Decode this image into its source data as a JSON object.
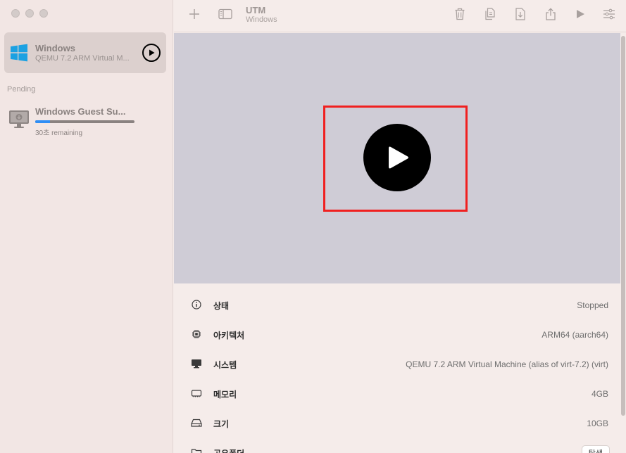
{
  "sidebar": {
    "vm": {
      "name": "Windows",
      "subtitle": "QEMU 7.2 ARM Virtual M..."
    },
    "section_label": "Pending",
    "pending": {
      "name": "Windows Guest Su...",
      "remaining": "30초 remaining",
      "progress": 0.15
    }
  },
  "toolbar": {
    "title": "UTM",
    "subtitle": "Windows"
  },
  "info": {
    "rows": [
      {
        "label": "상태",
        "value": "Stopped",
        "icon": "info-icon"
      },
      {
        "label": "아키텍처",
        "value": "ARM64 (aarch64)",
        "icon": "cpu-chip-icon"
      },
      {
        "label": "시스템",
        "value": "QEMU 7.2 ARM Virtual Machine (alias of virt-7.2) (virt)",
        "icon": "display-icon"
      },
      {
        "label": "메모리",
        "value": "4GB",
        "icon": "memory-icon"
      },
      {
        "label": "크기",
        "value": "10GB",
        "icon": "disk-drive-icon"
      },
      {
        "label": "공유폴더",
        "value": "",
        "icon": "folder-icon"
      }
    ],
    "browse_label": "탐색"
  },
  "colors": {
    "accent": "#2f8ef5",
    "highlight": "#f02020",
    "windows_blue": "#1ba1e2"
  }
}
